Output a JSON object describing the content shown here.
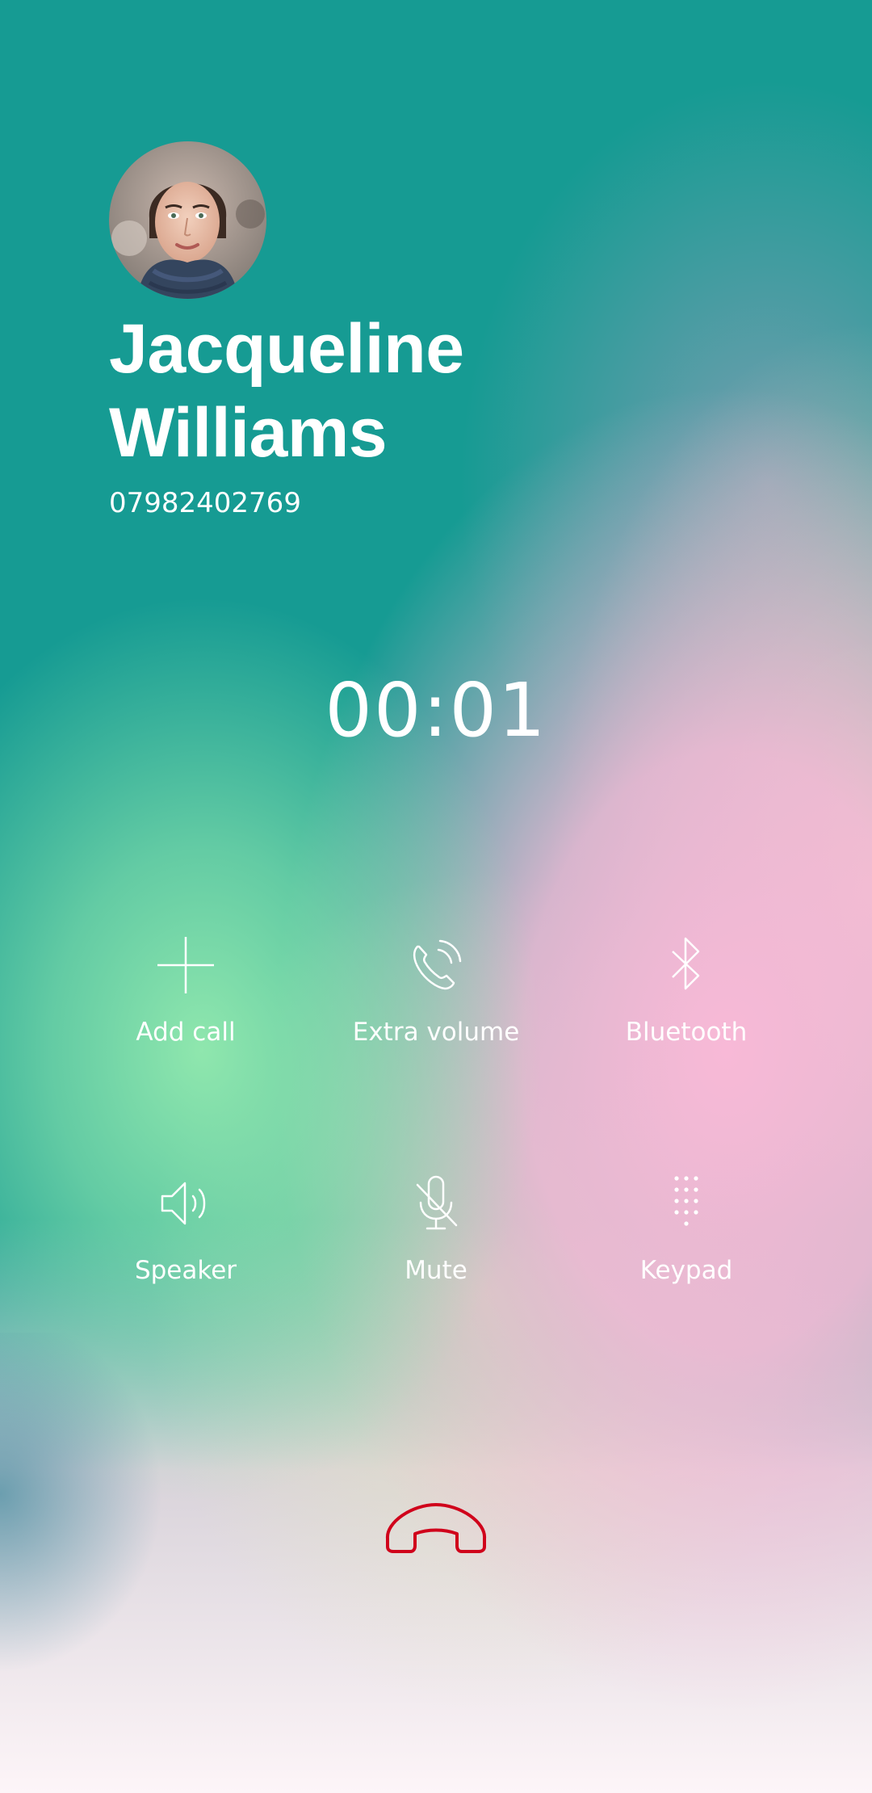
{
  "contact": {
    "name_line1": "Jacqueline",
    "name_line2": "Williams",
    "phone": "07982402769",
    "avatar": "contact-photo-woman"
  },
  "call": {
    "timer": "00:01"
  },
  "actions": [
    {
      "label": "Add call",
      "icon": "plus-icon"
    },
    {
      "label": "Extra volume",
      "icon": "phone-volume-icon"
    },
    {
      "label": "Bluetooth",
      "icon": "bluetooth-icon"
    },
    {
      "label": "Speaker",
      "icon": "speaker-icon"
    },
    {
      "label": "Mute",
      "icon": "mic-off-icon"
    },
    {
      "label": "Keypad",
      "icon": "dialpad-icon"
    }
  ],
  "end_call": {
    "icon": "end-call-icon",
    "color": "#d0021b"
  },
  "colors": {
    "teal": "#169b93",
    "green": "#96ebaf",
    "pink": "#f8b9d7",
    "text": "#ffffff"
  }
}
